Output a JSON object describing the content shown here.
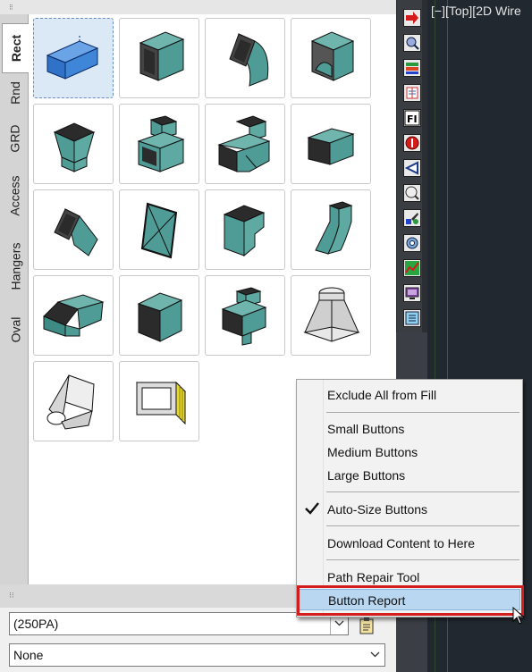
{
  "palette": {
    "tabs": [
      "Rect",
      "Rnd",
      "GRD",
      "Access",
      "Hangers",
      "Oval"
    ],
    "active_tab": "Rect",
    "fittings": [
      {
        "icon": "straight-duct-icon"
      },
      {
        "icon": "square-elbow-icon"
      },
      {
        "icon": "radius-elbow-icon"
      },
      {
        "icon": "radius-elbow-vane-icon"
      },
      {
        "icon": "square-transition-icon"
      },
      {
        "icon": "tee-transition-icon"
      },
      {
        "icon": "branch-wye-icon"
      },
      {
        "icon": "offset-duct-icon"
      },
      {
        "icon": "angled-elbow-icon"
      },
      {
        "icon": "end-cap-icon"
      },
      {
        "icon": "radius-tee-icon"
      },
      {
        "icon": "ogee-offset-icon"
      },
      {
        "icon": "reducer-icon"
      },
      {
        "icon": "square-box-icon"
      },
      {
        "icon": "box-tee-icon"
      },
      {
        "icon": "round-to-rect-icon"
      },
      {
        "icon": "rect-to-oval-icon"
      },
      {
        "icon": "flex-connector-icon"
      }
    ]
  },
  "viewport": {
    "label": "[−][Top][2D Wire"
  },
  "toolbar": {
    "buttons": [
      "arrow-right-icon",
      "zoom-icon",
      "layers-icon",
      "book-icon",
      "fill-icon",
      "stop-icon",
      "play-back-icon",
      "magnify-icon",
      "paint-icon",
      "gear-icon",
      "graph-icon",
      "display-icon",
      "list-icon"
    ]
  },
  "bottom": {
    "combo_a_value": "(250PA)",
    "combo_b_value": "None"
  },
  "context_menu": {
    "exclude_fill": "Exclude All from Fill",
    "small_buttons": "Small Buttons",
    "medium_buttons": "Medium Buttons",
    "large_buttons": "Large Buttons",
    "auto_size": "Auto-Size Buttons",
    "download_content": "Download Content to Here",
    "path_repair": "Path Repair Tool",
    "button_report": "Button Report",
    "auto_size_checked": true,
    "highlighted_item": "Button Report"
  },
  "colors": {
    "duct_teal": "#4f9b95",
    "duct_blue": "#2f72c7",
    "highlight_red": "#d21d1d",
    "menu_hover": "#b9d7f0"
  }
}
